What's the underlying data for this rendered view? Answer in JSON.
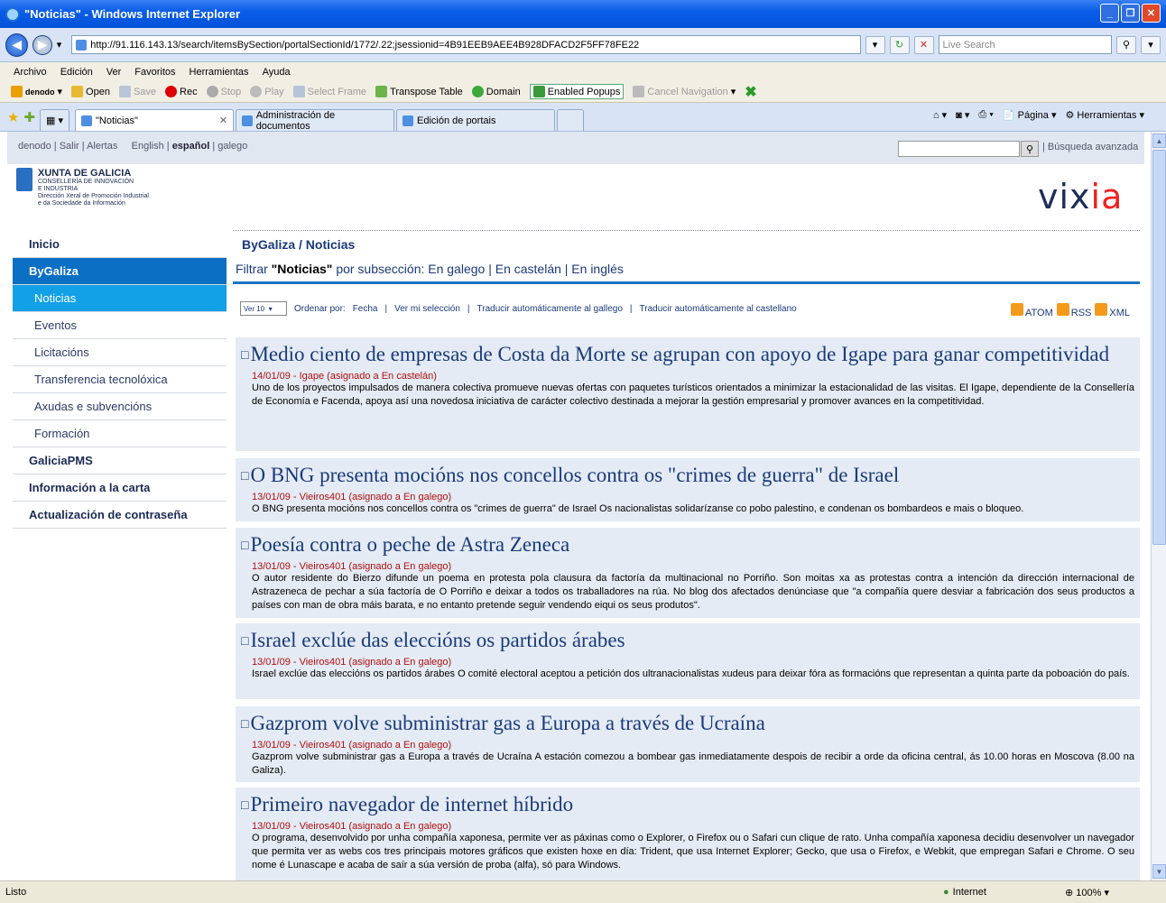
{
  "window": {
    "title": "\"Noticias\" - Windows Internet Explorer"
  },
  "address": {
    "url": "http://91.116.143.13/search/itemsBySection/portalSectionId/1772/.22;jsessionid=4B91EEB9AEE4B928DFACD2F5FF78FE22",
    "search_placeholder": "Live Search"
  },
  "menu": [
    "Archivo",
    "Edición",
    "Ver",
    "Favoritos",
    "Herramientas",
    "Ayuda"
  ],
  "toolbar": {
    "denodo": "denodo",
    "open": "Open",
    "save": "Save",
    "rec": "Rec",
    "stop": "Stop",
    "play": "Play",
    "select_frame": "Select Frame",
    "transpose": "Transpose Table",
    "domain": "Domain",
    "popups": "Enabled Popups",
    "cancel_nav": "Cancel Navigation"
  },
  "tabs": [
    {
      "label": "\"Noticias\""
    },
    {
      "label": "Administración de documentos"
    },
    {
      "label": "Edición de portais"
    }
  ],
  "commandbar": {
    "pagina": "Página",
    "herramientas": "Herramientas"
  },
  "top": {
    "denodo": "denodo",
    "salir": "Salir",
    "alertas": "Alertas",
    "english": "English",
    "espanol": "español",
    "galego": "galego",
    "busqueda": "| Búsqueda avanzada"
  },
  "logo": {
    "title": "XUNTA DE GALICIA",
    "line1": "CONSELLERÍA DE INNOVACIÓN",
    "line2": "E INDUSTRIA",
    "line3": "Dirección Xeral de Promoción Industrial",
    "line4": "e da Sociedade da Información",
    "brand_a": "vix",
    "brand_b": "ia"
  },
  "sidebar": [
    {
      "label": "Inicio",
      "kind": "top"
    },
    {
      "label": "ByGaliza",
      "kind": "active"
    },
    {
      "label": "Noticias",
      "kind": "subsel"
    },
    {
      "label": "Eventos",
      "kind": "sub"
    },
    {
      "label": "Licitacións",
      "kind": "sub"
    },
    {
      "label": "Transferencia tecnolóxica",
      "kind": "sub"
    },
    {
      "label": "Axudas e subvencións",
      "kind": "sub"
    },
    {
      "label": "Formación",
      "kind": "sub"
    },
    {
      "label": "GaliciaPMS",
      "kind": "top"
    },
    {
      "label": "Información a la carta",
      "kind": "top"
    },
    {
      "label": "Actualización de contraseña",
      "kind": "top"
    }
  ],
  "main": {
    "breadcrumb": "ByGaliza / Noticias",
    "filter_prefix": "Filtrar",
    "filter_section": "\"Noticias\"",
    "filter_rest": "por subsección: En galego | En castelán | En inglés",
    "ver": "Ver 10",
    "ordenar": "Ordenar por:",
    "fecha": "Fecha",
    "seleccion": "Ver mi selección",
    "trad_gal": "Traducir automáticamente al gallego",
    "trad_cas": "Traducir automáticamente al castellano",
    "atom": "ATOM",
    "rss": "RSS",
    "xml": "XML"
  },
  "news": [
    {
      "title": "Medio ciento de empresas de Costa da Morte se agrupan con apoyo de Igape para ganar competitividad",
      "meta": "14/01/09 - Igape (asignado a En castelán)",
      "desc": "Uno de los proyectos impulsados de manera colectiva promueve nuevas ofertas con paquetes turísticos orientados a minimizar la estacionalidad de las visitas. El Igape, dependiente de la Consellería de Economía e Facenda, apoya así una novedosa iniciativa de carácter colectivo destinada a mejorar la gestión empresarial y promover avances en la competitividad."
    },
    {
      "title": "O BNG presenta mocións nos concellos contra os \"crimes de guerra\" de Israel",
      "meta": "13/01/09 - Vieiros401 (asignado a En galego)",
      "desc": "O BNG presenta mocións nos concellos contra os \"crimes de guerra\" de Israel Os nacionalistas solidarízanse co pobo palestino, e condenan os bombardeos e mais o bloqueo."
    },
    {
      "title": "Poesía contra o peche de Astra Zeneca",
      "meta": "13/01/09 - Vieiros401 (asignado a En galego)",
      "desc": "O autor residente do Bierzo difunde un poema en protesta pola clausura da factoría da multinacional no Porriño. Son moitas xa as protestas contra a intención da dirección internacional de Astrazeneca de pechar a súa factoría de O Porriño e deixar a todos os traballadores na rúa. No blog dos afectados denúnciase que \"a compañía quere desviar a fabricación dos seus productos a países con man de obra máis barata, e no entanto pretende seguir vendendo eiqui os seus produtos\"."
    },
    {
      "title": "Israel exclúe das eleccións os partidos árabes",
      "meta": "13/01/09 - Vieiros401 (asignado a En galego)",
      "desc": "Israel exclúe das eleccións os partidos árabes O comité electoral aceptou a petición dos ultranacionalistas xudeus para deixar fóra as formacións que representan a quinta parte da poboación do país."
    },
    {
      "title": "Gazprom volve subministrar gas a Europa a través de Ucraína",
      "meta": "13/01/09 - Vieiros401 (asignado a En galego)",
      "desc": "Gazprom volve subministrar gas a Europa a través de Ucraína A estación comezou a bombear gas inmediatamente despois de recibir a orde da oficina central, ás 10.00 horas en Moscova (8.00 na Galiza)."
    },
    {
      "title": "Primeiro navegador de internet híbrido",
      "meta": "13/01/09 - Vieiros401 (asignado a En galego)",
      "desc": "O programa, desenvolvido por unha compañía xaponesa, permite ver as páxinas como o Explorer, o Firefox ou o Safari cun clique de rato. Unha compañía xaponesa decidiu desenvolver un navegador que permita ver as webs cos tres principais motores gráficos que existen hoxe en día: Trident, que usa Internet Explorer; Gecko, que usa o Firefox, e Webkit, que empregan Safari e Chrome. O seu nome é Lunascape e acaba de saír a súa versión de proba (alfa), só para Windows."
    }
  ],
  "status": {
    "left": "Listo",
    "zone": "Internet",
    "zoom": "100%"
  }
}
